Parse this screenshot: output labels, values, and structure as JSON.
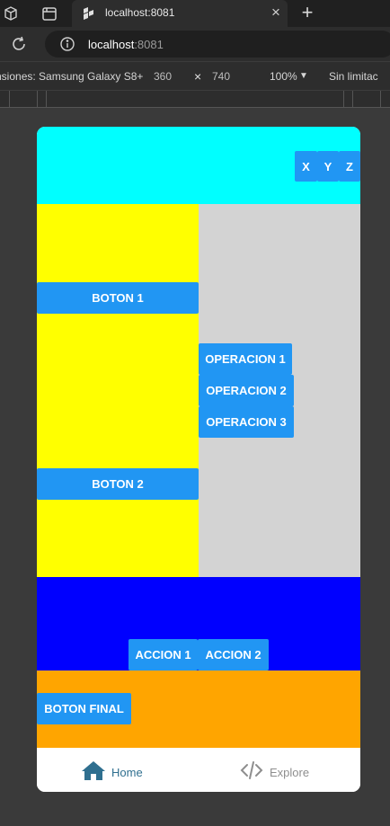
{
  "browser": {
    "tab_title": "localhost:8081",
    "url_host": "localhost",
    "url_port": ":8081",
    "close_glyph": "×",
    "new_tab_glyph": "+"
  },
  "devtools": {
    "device_label": "nsiones: Samsung Galaxy S8+",
    "width": "360",
    "x_glyph": "×",
    "height": "740",
    "zoom": "100%",
    "zoom_caret": "▼",
    "throttle": "Sin limitac"
  },
  "app": {
    "header_buttons": [
      "X",
      "Y",
      "Z"
    ],
    "left_buttons": [
      "BOTON 1",
      "BOTON 2"
    ],
    "operations": [
      "OPERACION 1",
      "OPERACION 2",
      "OPERACION 3"
    ],
    "actions": [
      "ACCION 1",
      "ACCION 2"
    ],
    "final_button": "BOTON FINAL",
    "colors": {
      "header": "#00ffff",
      "left_panel": "#ffff00",
      "right_panel": "#d3d3d3",
      "actions_panel": "#0000ff",
      "footer_panel": "#ffa500",
      "button": "#2196f3"
    }
  },
  "tabbar": {
    "items": [
      {
        "label": "Home",
        "icon": "home-icon",
        "active": true
      },
      {
        "label": "Explore",
        "icon": "code-icon",
        "active": false
      }
    ]
  }
}
